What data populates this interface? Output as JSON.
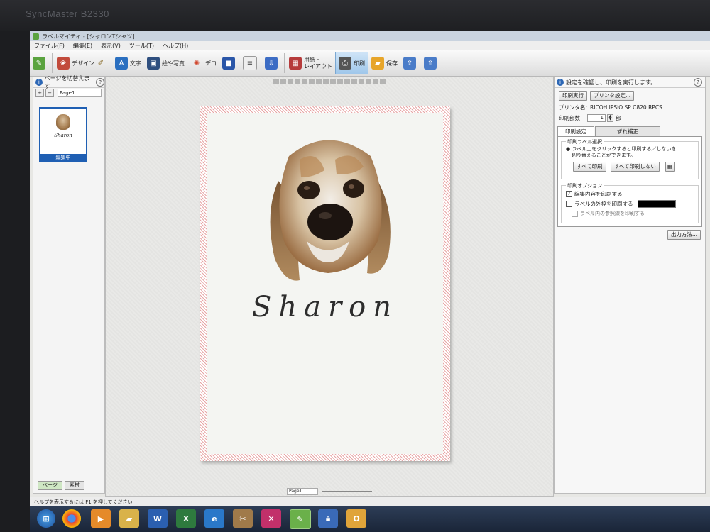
{
  "monitor": {
    "brand": "SyncMaster B2330"
  },
  "window": {
    "title": "ラベルマイティ - [シャロンTシャツ]"
  },
  "menu": [
    "ファイル(F)",
    "編集(E)",
    "表示(V)",
    "ツール(T)",
    "ヘルプ(H)"
  ],
  "toolbar": {
    "design": "デザイン",
    "text": "文字",
    "illust": "絵や写真",
    "deco": "デコ",
    "paper_line1": "用紙・",
    "paper_line2": "レイアウト",
    "print": "印刷",
    "save": "保存"
  },
  "left_panel": {
    "header": "ページを切替えます",
    "page_field": "Page1",
    "thumb_name": "Sharon",
    "thumb_status": "編集中",
    "tab_page": "ページ",
    "tab_material": "素材"
  },
  "canvas": {
    "label_text": "Sharon",
    "page_field": "Page1"
  },
  "right_panel": {
    "header": "設定を確認し、印刷を実行します。",
    "btn_print": "印刷実行",
    "btn_printer_settings": "プリンタ設定...",
    "printer_label": "プリンタ名:",
    "printer_name": "RICOH IPSiO SP C820 RPCS",
    "copies_label": "印刷部数",
    "copies_value": "1",
    "copies_unit": "部",
    "tab_print_settings": "印刷設定",
    "tab_offset": "ずれ補正",
    "group_label_select": "印刷ラベル選択",
    "label_select_hint1": "ラベル上をクリックすると印刷する／しないを",
    "label_select_hint2": "切り替えることができます。",
    "btn_print_all": "すべて印刷",
    "btn_print_none": "すべて印刷しない",
    "group_options": "印刷オプション",
    "opt_edit_content": "編集内容を印刷する",
    "opt_outer_frame": "ラベルの外枠を印刷する",
    "opt_guide_lines": "ラベル内の参照線を印刷する",
    "btn_output_method": "出力方法..."
  },
  "statusbar": {
    "text": "ヘルプを表示するには F1 を押してください"
  },
  "colors": {
    "accent": "#1f5fb3",
    "label_border": "#e7a5a5",
    "frame_color": "#000000"
  }
}
